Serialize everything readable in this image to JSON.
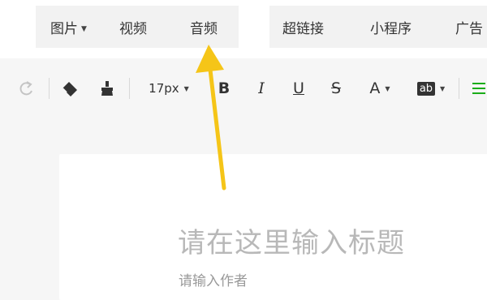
{
  "menu": {
    "media": [
      {
        "label": "图片",
        "dropdown": true
      },
      {
        "label": "视频"
      },
      {
        "label": "音频"
      }
    ],
    "links": [
      {
        "label": "超链接"
      },
      {
        "label": "小程序"
      },
      {
        "label": "广告"
      }
    ]
  },
  "toolbar": {
    "font_size": "17px",
    "bold": "B",
    "italic": "I",
    "underline": "U",
    "strike": "S",
    "font_color": "A",
    "highlight": "ab"
  },
  "editor": {
    "title_placeholder": "请在这里输入标题",
    "author_placeholder": "请输入作者"
  },
  "colors": {
    "annotation_arrow": "#f5c518",
    "align_accent": "#1aad19"
  }
}
